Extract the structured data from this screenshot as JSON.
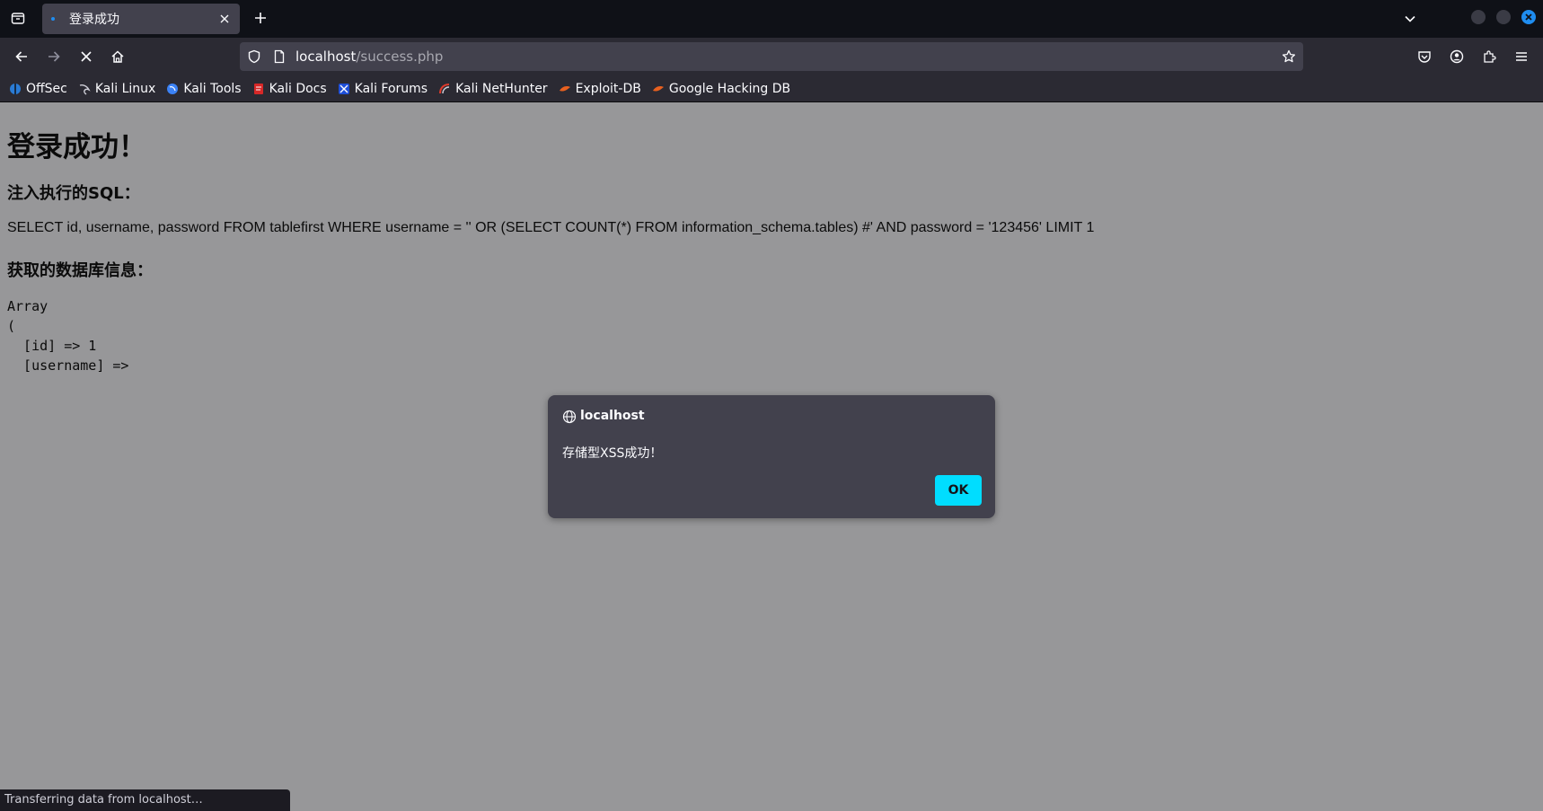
{
  "browser": {
    "tab": {
      "title": "登录成功"
    },
    "url": {
      "host": "localhost",
      "path": "/success.php"
    },
    "bookmarks": [
      {
        "label": "OffSec",
        "icon": "offsec-icon",
        "color": "#2a7bd5"
      },
      {
        "label": "Kali Linux",
        "icon": "kali-dragon-icon",
        "color": "#cfcfd8"
      },
      {
        "label": "Kali Tools",
        "icon": "kali-tools-icon",
        "color": "#3b82f6"
      },
      {
        "label": "Kali Docs",
        "icon": "kali-docs-icon",
        "color": "#d72828"
      },
      {
        "label": "Kali Forums",
        "icon": "kali-forums-icon",
        "color": "#3b82f6"
      },
      {
        "label": "Kali NetHunter",
        "icon": "nethunter-icon",
        "color": "#e03a2b"
      },
      {
        "label": "Exploit-DB",
        "icon": "exploit-db-icon",
        "color": "#e8601f"
      },
      {
        "label": "Google Hacking DB",
        "icon": "ghdb-icon",
        "color": "#e8601f"
      }
    ],
    "status": "Transferring data from localhost…"
  },
  "page": {
    "title": "登录成功！",
    "sql_heading": "注入执行的SQL：",
    "sql": "SELECT id, username, password FROM tablefirst WHERE username = '' OR (SELECT COUNT(*) FROM information_schema.tables) #' AND password = '123456' LIMIT 1",
    "db_heading": "获取的数据库信息：",
    "db_output": "Array\n(\n  [id] => 1\n  [username] =>"
  },
  "dialog": {
    "origin": "localhost",
    "message": "存储型XSS成功！",
    "ok_label": "OK"
  },
  "colors": {
    "accent": "#00ddff",
    "toolbar": "#2b2a33",
    "titlebar": "#0f1117",
    "page_background": "#979799"
  }
}
